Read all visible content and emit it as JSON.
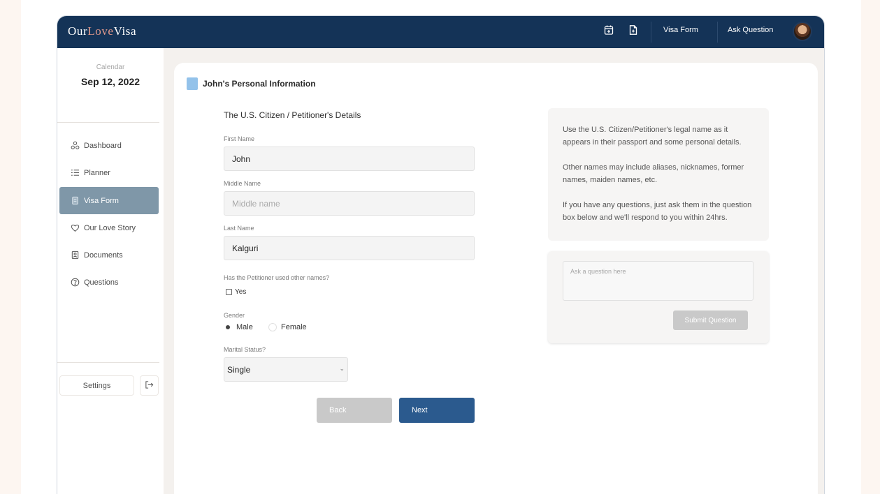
{
  "app": {
    "logo_part1": "Our",
    "logo_part2": "Love",
    "logo_part3": "Visa"
  },
  "topbar": {
    "links": [
      "Visa Form",
      "Ask Question"
    ],
    "icons": [
      "calendar-add-icon",
      "document-add-icon"
    ]
  },
  "sidebar": {
    "calendar_label": "Calendar",
    "calendar_date": "Sep 12, 2022",
    "items": [
      {
        "label": "Dashboard",
        "icon": "dashboard-icon",
        "active": false
      },
      {
        "label": "Planner",
        "icon": "planner-icon",
        "active": false
      },
      {
        "label": "Visa Form",
        "icon": "form-icon",
        "active": true
      },
      {
        "label": "Our Love Story",
        "icon": "heart-icon",
        "active": false
      },
      {
        "label": "Documents",
        "icon": "document-icon",
        "active": false
      },
      {
        "label": "Questions",
        "icon": "question-icon",
        "active": false
      }
    ],
    "settings_label": "Settings",
    "logout_icon": "logout-icon"
  },
  "form": {
    "card_title": "John's Personal Information",
    "section_title": "The U.S. Citizen / Petitioner's Details",
    "first_name_label": "First Name",
    "first_name_value": "John",
    "middle_name_label": "Middle Name",
    "middle_name_placeholder": "Middle name",
    "last_name_label": "Last Name",
    "last_name_value": "Kalguri",
    "other_names_label": "Has the Petitioner used other names?",
    "other_names_option": "Yes",
    "gender_label": "Gender",
    "gender_options": [
      "Male",
      "Female"
    ],
    "gender_selected": "Male",
    "marital_label": "Marital Status?",
    "marital_value": "Single",
    "back_label": "Back",
    "next_label": "Next"
  },
  "help": {
    "paragraphs": [
      "Use the U.S. Citizen/Petitioner's legal name as it appears in their passport and some personal details.",
      "Other names may include aliases, nicknames, former names, maiden names, etc.",
      "If you have any questions, just ask them in the question box below and we'll respond to you within 24hrs."
    ],
    "question_placeholder": "Ask a question here",
    "submit_label": "Submit Question"
  },
  "colors": {
    "topbar": "#143357",
    "active_nav": "#7f97a8",
    "primary_button": "#2b5a8e",
    "disabled_button": "#c9c9c9",
    "logo_accent": "#e39a8c",
    "card_marker": "#93c2ea"
  }
}
